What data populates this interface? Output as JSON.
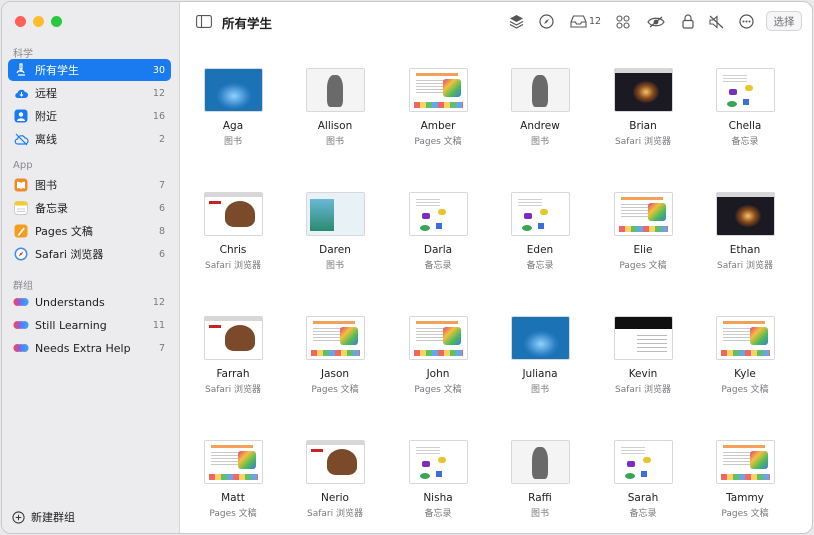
{
  "colors": {
    "accent": "#1a7bf1",
    "sidebar_bg": "#ececef",
    "window_bg": "#ffffff"
  },
  "toolbar": {
    "title": "所有学生",
    "inbox_count": "12",
    "select_label": "选择",
    "icons": [
      "sidebar-toggle-icon",
      "layers-icon",
      "compass-icon",
      "inbox-icon",
      "grid-icon",
      "hide-icon",
      "lock-icon",
      "mute-icon",
      "more-icon"
    ]
  },
  "sidebar": {
    "science_title": "科学",
    "science_items": [
      {
        "label": "所有学生",
        "count": "30",
        "icon": "microscope-icon"
      },
      {
        "label": "远程",
        "count": "12",
        "icon": "cloud-icon"
      },
      {
        "label": "附近",
        "count": "16",
        "icon": "person-icon"
      },
      {
        "label": "离线",
        "count": "2",
        "icon": "offline-icon"
      }
    ],
    "app_title": "App",
    "app_items": [
      {
        "label": "图书",
        "count": "7",
        "icon": "books-icon"
      },
      {
        "label": "备忘录",
        "count": "6",
        "icon": "notes-icon"
      },
      {
        "label": "Pages 文稿",
        "count": "8",
        "icon": "pages-icon"
      },
      {
        "label": "Safari 浏览器",
        "count": "6",
        "icon": "safari-icon"
      }
    ],
    "groups_title": "群组",
    "group_items": [
      {
        "label": "Understands",
        "count": "12",
        "icon": "group-icon"
      },
      {
        "label": "Still Learning",
        "count": "11",
        "icon": "group-icon"
      },
      {
        "label": "Needs Extra Help",
        "count": "7",
        "icon": "group-icon"
      }
    ],
    "new_group_label": "新建群组"
  },
  "students": [
    {
      "name": "Aga",
      "app": "图书",
      "thumb": "whale"
    },
    {
      "name": "Allison",
      "app": "图书",
      "thumb": "bird"
    },
    {
      "name": "Amber",
      "app": "Pages 文稿",
      "thumb": "pages"
    },
    {
      "name": "Andrew",
      "app": "图书",
      "thumb": "bird"
    },
    {
      "name": "Brian",
      "app": "Safari 浏览器",
      "thumb": "space"
    },
    {
      "name": "Chella",
      "app": "备忘录",
      "thumb": "notes"
    },
    {
      "name": "Chris",
      "app": "Safari 浏览器",
      "thumb": "mammoth"
    },
    {
      "name": "Daren",
      "app": "图书",
      "thumb": "reef"
    },
    {
      "name": "Darla",
      "app": "备忘录",
      "thumb": "notes"
    },
    {
      "name": "Eden",
      "app": "备忘录",
      "thumb": "notes"
    },
    {
      "name": "Elie",
      "app": "Pages 文稿",
      "thumb": "pages"
    },
    {
      "name": "Ethan",
      "app": "Safari 浏览器",
      "thumb": "space"
    },
    {
      "name": "Farrah",
      "app": "Safari 浏览器",
      "thumb": "mammoth"
    },
    {
      "name": "Jason",
      "app": "Pages 文稿",
      "thumb": "pages"
    },
    {
      "name": "John",
      "app": "Pages 文稿",
      "thumb": "pages"
    },
    {
      "name": "Juliana",
      "app": "图书",
      "thumb": "whale"
    },
    {
      "name": "Kevin",
      "app": "Safari 浏览器",
      "thumb": "kevin"
    },
    {
      "name": "Kyle",
      "app": "Pages 文稿",
      "thumb": "pages"
    },
    {
      "name": "Matt",
      "app": "Pages 文稿",
      "thumb": "pages"
    },
    {
      "name": "Nerio",
      "app": "Safari 浏览器",
      "thumb": "mammoth"
    },
    {
      "name": "Nisha",
      "app": "备忘录",
      "thumb": "notes"
    },
    {
      "name": "Raffi",
      "app": "图书",
      "thumb": "bird"
    },
    {
      "name": "Sarah",
      "app": "备忘录",
      "thumb": "notes"
    },
    {
      "name": "Tammy",
      "app": "Pages 文稿",
      "thumb": "pages"
    }
  ]
}
